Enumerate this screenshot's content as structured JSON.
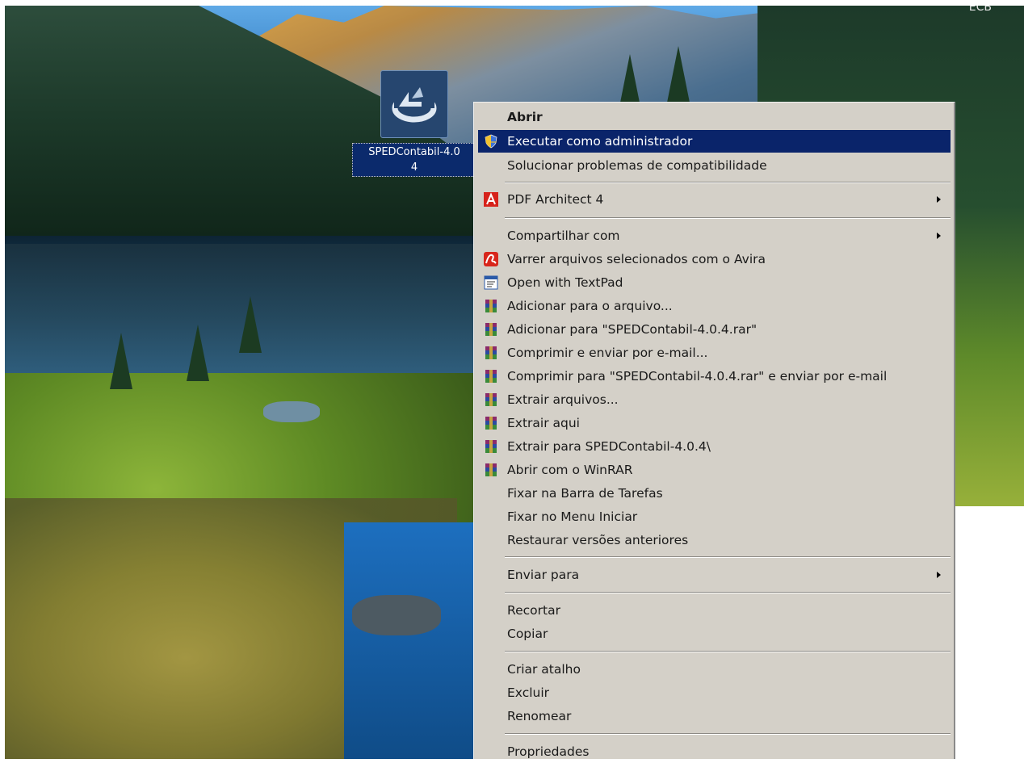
{
  "desktop": {
    "corner_text": "ECB",
    "icon": {
      "name": "SPEDContabil-4.0.4",
      "label_line1": "SPEDContabil-4.0",
      "label_line2": "4",
      "icon_name": "sped-installer-icon"
    }
  },
  "context_menu": {
    "items": [
      {
        "label": "Abrir",
        "bold": true,
        "icon": null
      },
      {
        "label": "Executar como administrador",
        "highlighted": true,
        "icon": "uac-shield-icon"
      },
      {
        "label": "Solucionar problemas de compatibilidade",
        "icon": null
      },
      {
        "label": "PDF Architect 4",
        "icon": "pdf-architect-icon",
        "submenu": true
      },
      {
        "label": "Compartilhar com",
        "icon": null,
        "submenu": true
      },
      {
        "label": "Varrer arquivos selecionados com o Avira",
        "icon": "avira-icon"
      },
      {
        "label": "Open with TextPad",
        "icon": "textpad-icon"
      },
      {
        "label": "Adicionar para o arquivo...",
        "icon": "winrar-icon"
      },
      {
        "label": "Adicionar para \"SPEDContabil-4.0.4.rar\"",
        "icon": "winrar-icon"
      },
      {
        "label": "Comprimir e enviar por e-mail...",
        "icon": "winrar-icon"
      },
      {
        "label": "Comprimir para \"SPEDContabil-4.0.4.rar\" e enviar por e-mail",
        "icon": "winrar-icon"
      },
      {
        "label": "Extrair arquivos...",
        "icon": "winrar-icon"
      },
      {
        "label": "Extrair aqui",
        "icon": "winrar-icon"
      },
      {
        "label": "Extrair para SPEDContabil-4.0.4\\",
        "icon": "winrar-icon"
      },
      {
        "label": "Abrir com o WinRAR",
        "icon": "winrar-icon"
      },
      {
        "label": "Fixar na Barra de Tarefas",
        "icon": null
      },
      {
        "label": "Fixar no Menu Iniciar",
        "icon": null
      },
      {
        "label": "Restaurar versões anteriores",
        "icon": null
      },
      {
        "label": "Enviar para",
        "icon": null,
        "submenu": true
      },
      {
        "label": "Recortar",
        "icon": null
      },
      {
        "label": "Copiar",
        "icon": null
      },
      {
        "label": "Criar atalho",
        "icon": null
      },
      {
        "label": "Excluir",
        "icon": null
      },
      {
        "label": "Renomear",
        "icon": null
      },
      {
        "label": "Propriedades",
        "icon": null
      }
    ]
  },
  "colors": {
    "menu_background": "#d4d0c8",
    "highlight": "#0a246a",
    "highlight_text": "#ffffff",
    "icon_label_background": "#0b2a6c"
  }
}
